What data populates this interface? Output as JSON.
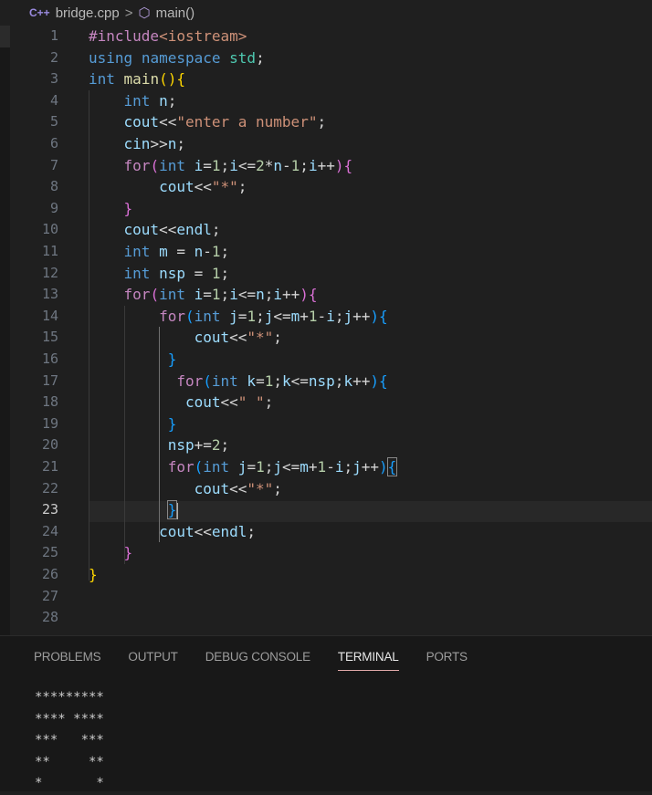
{
  "breadcrumb": {
    "file": "bridge.cpp",
    "separator": ">",
    "symbol": "main()"
  },
  "editor": {
    "line_numbers": [
      "1",
      "2",
      "3",
      "4",
      "5",
      "6",
      "7",
      "8",
      "9",
      "10",
      "11",
      "12",
      "13",
      "14",
      "15",
      "16",
      "17",
      "18",
      "19",
      "20",
      "21",
      "22",
      "23",
      "24",
      "25",
      "26",
      "27",
      "28"
    ],
    "active_line": "23"
  },
  "panel": {
    "tabs": [
      "PROBLEMS",
      "OUTPUT",
      "DEBUG CONSOLE",
      "TERMINAL",
      "PORTS"
    ],
    "active_tab": "TERMINAL"
  },
  "terminal": {
    "lines": [
      "*********",
      "**** ****",
      "***   ***",
      "**     **",
      "*       *"
    ]
  },
  "colors": {
    "background": "#1f1f1f",
    "keyword": "#c586c0",
    "type": "#569cd6",
    "string": "#ce9178",
    "number": "#b5cea8"
  }
}
